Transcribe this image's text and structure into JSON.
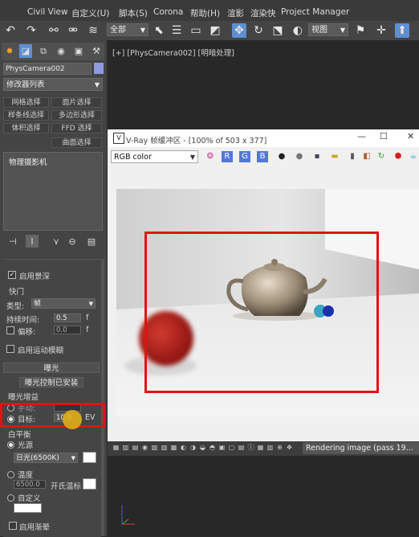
{
  "menubar": {
    "items": [
      "Civil View",
      "自定义(U)",
      "脚本(S)",
      "Corona",
      "帮助(H)",
      "渲影",
      "渲染快",
      "Project Manager"
    ]
  },
  "toolbar": {
    "selection_filter": "全部",
    "view_select": "视图"
  },
  "command_panel": {
    "object_name": "PhysCamera002",
    "object_color": "#8e9ae0",
    "modifier_list": "修改器列表",
    "buttons": [
      "网格选择",
      "面片选择",
      "样条线选择",
      "多边形选择",
      "体积选择",
      "FFD 选择",
      "曲面选择"
    ],
    "stack_item": "物理摄影机"
  },
  "rollout": {
    "enable_dof": "启用景深",
    "shutter_header": "快门",
    "type_label": "类型:",
    "type_value": "帧",
    "duration_label": "持续时间:",
    "duration_value": "0.5",
    "duration_unit": "f",
    "offset_label": "偏移:",
    "offset_value": "0.0",
    "offset_unit": "f",
    "motion_blur": "启用运动模糊",
    "exposure_section": "曝光",
    "exposure_control": "曝光控制已安装",
    "exposure_gain": "曝光增益",
    "manual_label": "手动:",
    "target_label": "目标:",
    "target_value": "10.0",
    "target_unit": "EV",
    "white_balance": "白平衡",
    "light_source": "光源",
    "light_value": "日光(6500K)",
    "temperature": "温度",
    "temperature_value": "6500.0",
    "temp_suffix": "开氏温标",
    "custom": "自定义",
    "enable_vignette": "启用渐晕"
  },
  "viewport": {
    "label": "[+] [PhysCamera002] [明暗处理]"
  },
  "vfb": {
    "title": "V-Ray 帧缓冲区 - [100% of 503 x 377]",
    "channel": "RGB color",
    "status": "Rendering image (pass 19..."
  },
  "colors": {
    "highlight": "#e31212",
    "accent": "#5e8fd0"
  }
}
